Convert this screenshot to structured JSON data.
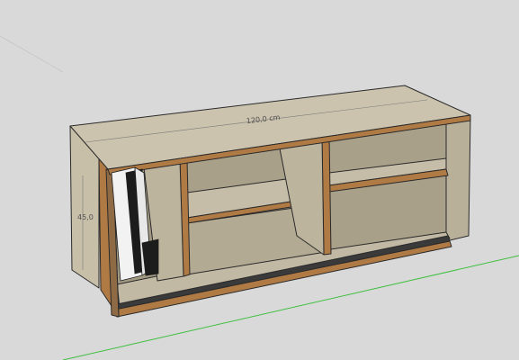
{
  "dimensions": {
    "width_label": "120,0 cm",
    "height_label": "45,0"
  },
  "colors": {
    "background": "#d9d9d9",
    "wood_top": "#c9c0ac",
    "wood_side": "#b8af99",
    "wood_inner": "#a89f89",
    "edge_band": "#b07a45",
    "outline": "#2a2a2a",
    "ground_axis": "#3fbf3f",
    "console_white": "#f2f2f2",
    "console_black": "#1c1c1c"
  },
  "objects": {
    "cabinet": "tv-cabinet",
    "device": "game-console-vertical"
  }
}
